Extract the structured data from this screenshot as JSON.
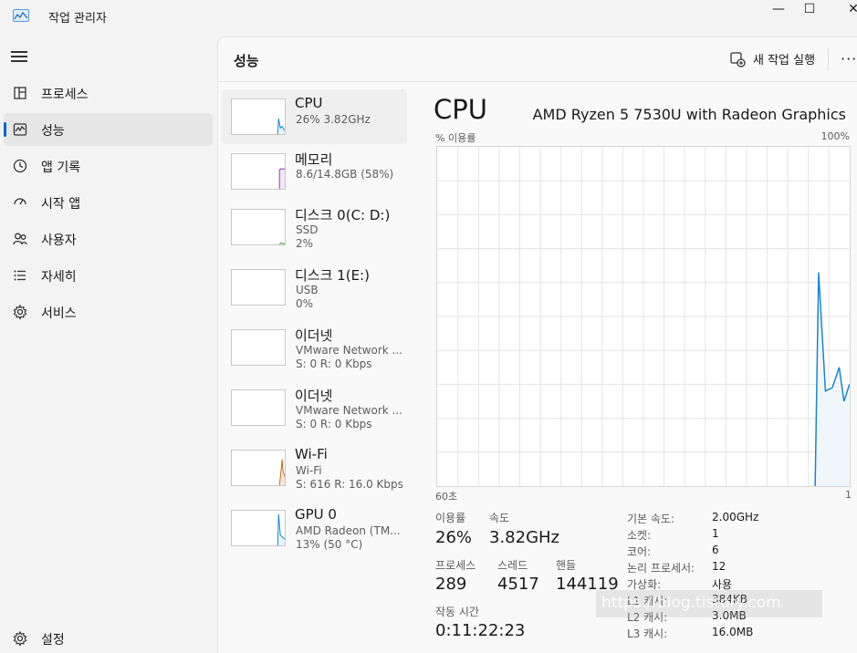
{
  "window": {
    "title": "작업 관리자",
    "controls": {
      "minimize": "—",
      "maximize": "☐",
      "close": "✕"
    }
  },
  "sidebar": {
    "menu_icon": "hamburger-icon",
    "items": [
      {
        "label": "프로세스",
        "icon": "processes-icon",
        "active": false
      },
      {
        "label": "성능",
        "icon": "performance-icon",
        "active": true
      },
      {
        "label": "앱 기록",
        "icon": "app-history-icon",
        "active": false
      },
      {
        "label": "시작 앱",
        "icon": "startup-apps-icon",
        "active": false
      },
      {
        "label": "사용자",
        "icon": "users-icon",
        "active": false
      },
      {
        "label": "자세히",
        "icon": "details-icon",
        "active": false
      },
      {
        "label": "서비스",
        "icon": "services-icon",
        "active": false
      }
    ],
    "settings_label": "설정"
  },
  "header": {
    "title": "성능",
    "run_task_label": "새 작업 실행",
    "more_label": "···"
  },
  "devices": [
    {
      "name": "CPU",
      "line1": "26%  3.82GHz",
      "line2": "",
      "color": "#1a86c8"
    },
    {
      "name": "메모리",
      "line1": "8.6/14.8GB (58%)",
      "line2": "",
      "color": "#8c3fa8"
    },
    {
      "name": "디스크 0(C: D:)",
      "line1": "SSD",
      "line2": "2%",
      "color": "#4c9a2a"
    },
    {
      "name": "디스크 1(E:)",
      "line1": "USB",
      "line2": "0%",
      "color": "#4c9a2a"
    },
    {
      "name": "이더넷",
      "line1": "VMware Network ...",
      "line2": "S: 0  R: 0 Kbps",
      "color": "#a0522d"
    },
    {
      "name": "이더넷",
      "line1": "VMware Network ...",
      "line2": "S: 0  R: 0 Kbps",
      "color": "#a0522d"
    },
    {
      "name": "Wi-Fi",
      "line1": "Wi-Fi",
      "line2": "S: 616  R: 16.0 Kbps",
      "color": "#c8651a"
    },
    {
      "name": "GPU 0",
      "line1": "AMD Radeon (TM...",
      "line2": "13%  (50 °C)",
      "color": "#1a86c8"
    }
  ],
  "cpu_panel": {
    "title": "CPU",
    "model": "AMD Ryzen 5 7530U with Radeon Graphics",
    "graph_label_left": "% 이용률",
    "graph_label_right": "100%",
    "time_label_left": "60초",
    "time_label_right": "1",
    "graph_line_color": "#1a86c8",
    "graph_fill_color": "#f1f6fa",
    "utilization_label": "이용률",
    "utilization_value": "26%",
    "speed_label": "속도",
    "speed_value": "3.82GHz",
    "processes_label": "프로세스",
    "processes_value": "289",
    "threads_label": "스레드",
    "threads_value": "4517",
    "handles_label": "핸들",
    "handles_value": "144119",
    "uptime_label": "작동 시간",
    "uptime_value": "0:11:22:23",
    "specs": [
      {
        "label": "기본 속도:",
        "value": "2.00GHz"
      },
      {
        "label": "소켓:",
        "value": "1"
      },
      {
        "label": "코어:",
        "value": "6"
      },
      {
        "label": "논리 프로세서:",
        "value": "12"
      },
      {
        "label": "가상화:",
        "value": "사용"
      },
      {
        "label": "L1 캐시:",
        "value": "384KB"
      },
      {
        "label": "L2 캐시:",
        "value": "3.0MB"
      },
      {
        "label": "L3 캐시:",
        "value": "16.0MB"
      }
    ],
    "watermark": "https://blog.tistory.com"
  },
  "chart_data": {
    "type": "line",
    "title": "",
    "xlabel": "",
    "ylabel": "% 이용률",
    "xlim": [
      60,
      0
    ],
    "ylim": [
      0,
      100
    ],
    "x": [
      5,
      4.5,
      3.5,
      2.5,
      1.5,
      0.8,
      0
    ],
    "values": [
      0,
      63,
      28,
      29,
      35,
      25,
      30
    ],
    "grid": true
  }
}
